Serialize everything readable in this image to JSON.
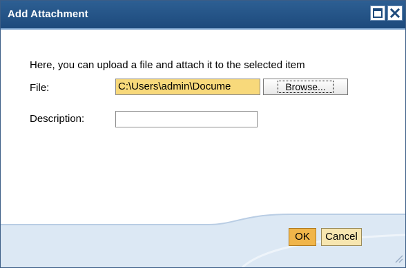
{
  "window": {
    "title": "Add Attachment",
    "maximize_icon": "maximize-icon",
    "close_icon": "close-icon"
  },
  "content": {
    "intro": "Here, you can upload a file and attach it to the selected item",
    "file_label": "File:",
    "file_value": "C:\\Users\\admin\\Docume",
    "browse_label": "Browse...",
    "description_label": "Description:",
    "description_value": ""
  },
  "buttons": {
    "ok_label": "OK",
    "cancel_label": "Cancel"
  },
  "colors": {
    "titlebar": "#2d5f93",
    "file_field_bg": "#f8d97b",
    "ok_bg": "#f0b54a",
    "cancel_bg": "#f7e6b0",
    "footer_bg": "#dce8f4"
  }
}
